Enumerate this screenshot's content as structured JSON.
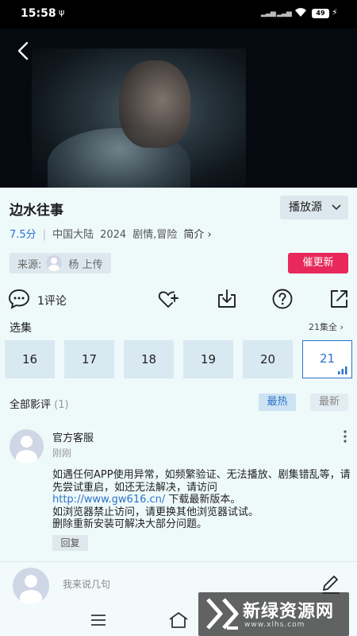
{
  "status_bar": {
    "time": "15:58",
    "battery": "49",
    "usb_icon": "usb-icon",
    "wifi_icon": "wifi-icon"
  },
  "video": {
    "back_icon": "chevron-left-icon"
  },
  "show": {
    "title": "边水往事",
    "source_label": "播放源",
    "score": "7.5分",
    "region": "中国大陆",
    "year": "2024",
    "genres": "剧情,冒险",
    "brief_label": "简介",
    "brief_chevron": "›"
  },
  "uploader": {
    "prefix": "来源:",
    "name": "杨 上传"
  },
  "urge_button": "催更新",
  "actions": {
    "comment_count": "1评论",
    "icons": [
      "comment-icon",
      "favorite-add-icon",
      "download-icon",
      "help-icon",
      "share-icon"
    ]
  },
  "episodes": {
    "title": "选集",
    "all_label": "21集全 ›",
    "items": [
      "16",
      "17",
      "18",
      "19",
      "20",
      "21"
    ],
    "active": "21"
  },
  "reviews": {
    "title": "全部影评",
    "count": "(1)",
    "tab_hot": "最热",
    "tab_new": "最新",
    "items": [
      {
        "author": "官方客服",
        "time": "刚刚",
        "line1": "如遇任何APP使用异常，如频繁验证、无法播放、剧集错乱等，请先尝试重启，如还无法解决，请访问",
        "link": "http://www.gw616.cn/",
        "line2": " 下载最新版本。",
        "line3": "如浏览器禁止访问，请更换其他浏览器试试。",
        "line4": "删除重新安装可解决大部分问题。",
        "reply_label": "回复"
      }
    ]
  },
  "compose": {
    "placeholder": "我来说几句"
  },
  "watermark": {
    "text": "新绿资源网",
    "url": "www.xlhs.com"
  },
  "colors": {
    "accent": "#2e73c8",
    "urge": "#e8285a",
    "background": "#eef9fa",
    "episode_bg": "#d9e9f2"
  }
}
